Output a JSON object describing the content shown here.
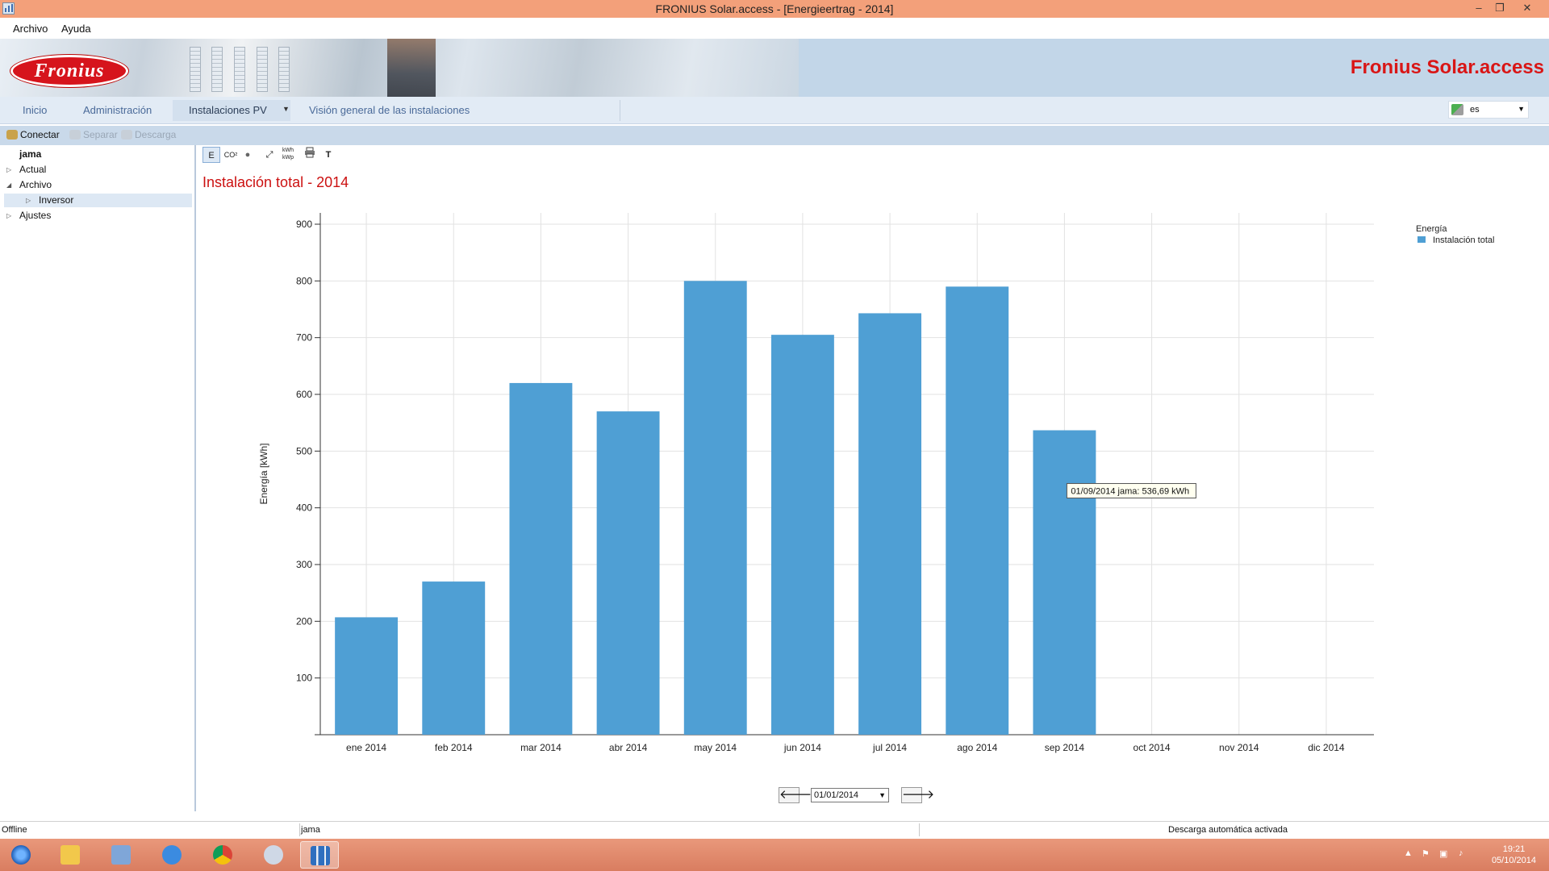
{
  "window": {
    "title": "FRONIUS Solar.access - [Energieertrag - 2014]",
    "minimize_glyph": "–",
    "restore_glyph": "❐",
    "close_glyph": "✕"
  },
  "menu": {
    "items": [
      "Archivo",
      "Ayuda"
    ]
  },
  "banner": {
    "logo_text": "Fronius",
    "brand": "Fronius Solar.access"
  },
  "nav": {
    "tabs": [
      "Inicio",
      "Administración",
      "Instalaciones PV",
      "Visión general de las instalaciones"
    ],
    "active_tab": "Instalaciones PV",
    "language": "es"
  },
  "toolbar": {
    "connect": "Conectar",
    "disconnect": "Separar",
    "download": "Descarga"
  },
  "tree": {
    "root": "jama",
    "items": [
      {
        "label": "Actual",
        "expanded": false
      },
      {
        "label": "Archivo",
        "expanded": true
      },
      {
        "label": "Inversor",
        "expanded": false,
        "selected": true
      },
      {
        "label": "Ajustes",
        "expanded": false
      }
    ]
  },
  "chart_toolbar": {
    "buttons": [
      "E",
      "CO²",
      "●",
      "⤢",
      "kWh kWp",
      "print",
      "T"
    ]
  },
  "chart_data": {
    "type": "bar",
    "title": "Instalación total - 2014",
    "categories": [
      "ene 2014",
      "feb 2014",
      "mar 2014",
      "abr 2014",
      "may 2014",
      "jun 2014",
      "jul 2014",
      "ago 2014",
      "sep 2014",
      "oct 2014",
      "nov 2014",
      "dic 2014"
    ],
    "series": [
      {
        "name": "Instalación total",
        "values": [
          207,
          270,
          620,
          570,
          800,
          705,
          743,
          790,
          536.69,
          null,
          null,
          null
        ],
        "color": "#4f9fd4"
      }
    ],
    "ylabel": "Energía [kWh]",
    "xlabel": "",
    "ylim": [
      0,
      900
    ],
    "yticks": [
      100,
      200,
      300,
      400,
      500,
      600,
      700,
      800,
      900
    ],
    "grid": true,
    "legend": {
      "title": "Energía",
      "position": "top-right"
    },
    "tooltip": "01/09/2014 jama: 536,69 kWh"
  },
  "date_nav": {
    "date": "01/01/2014",
    "prev_glyph": "🡐",
    "next_glyph": "🡒"
  },
  "status": {
    "connection": "Offline",
    "system": "jama",
    "auto_download": "Descarga automática activada"
  },
  "taskbar": {
    "time": "19:21",
    "date": "05/10/2014"
  }
}
